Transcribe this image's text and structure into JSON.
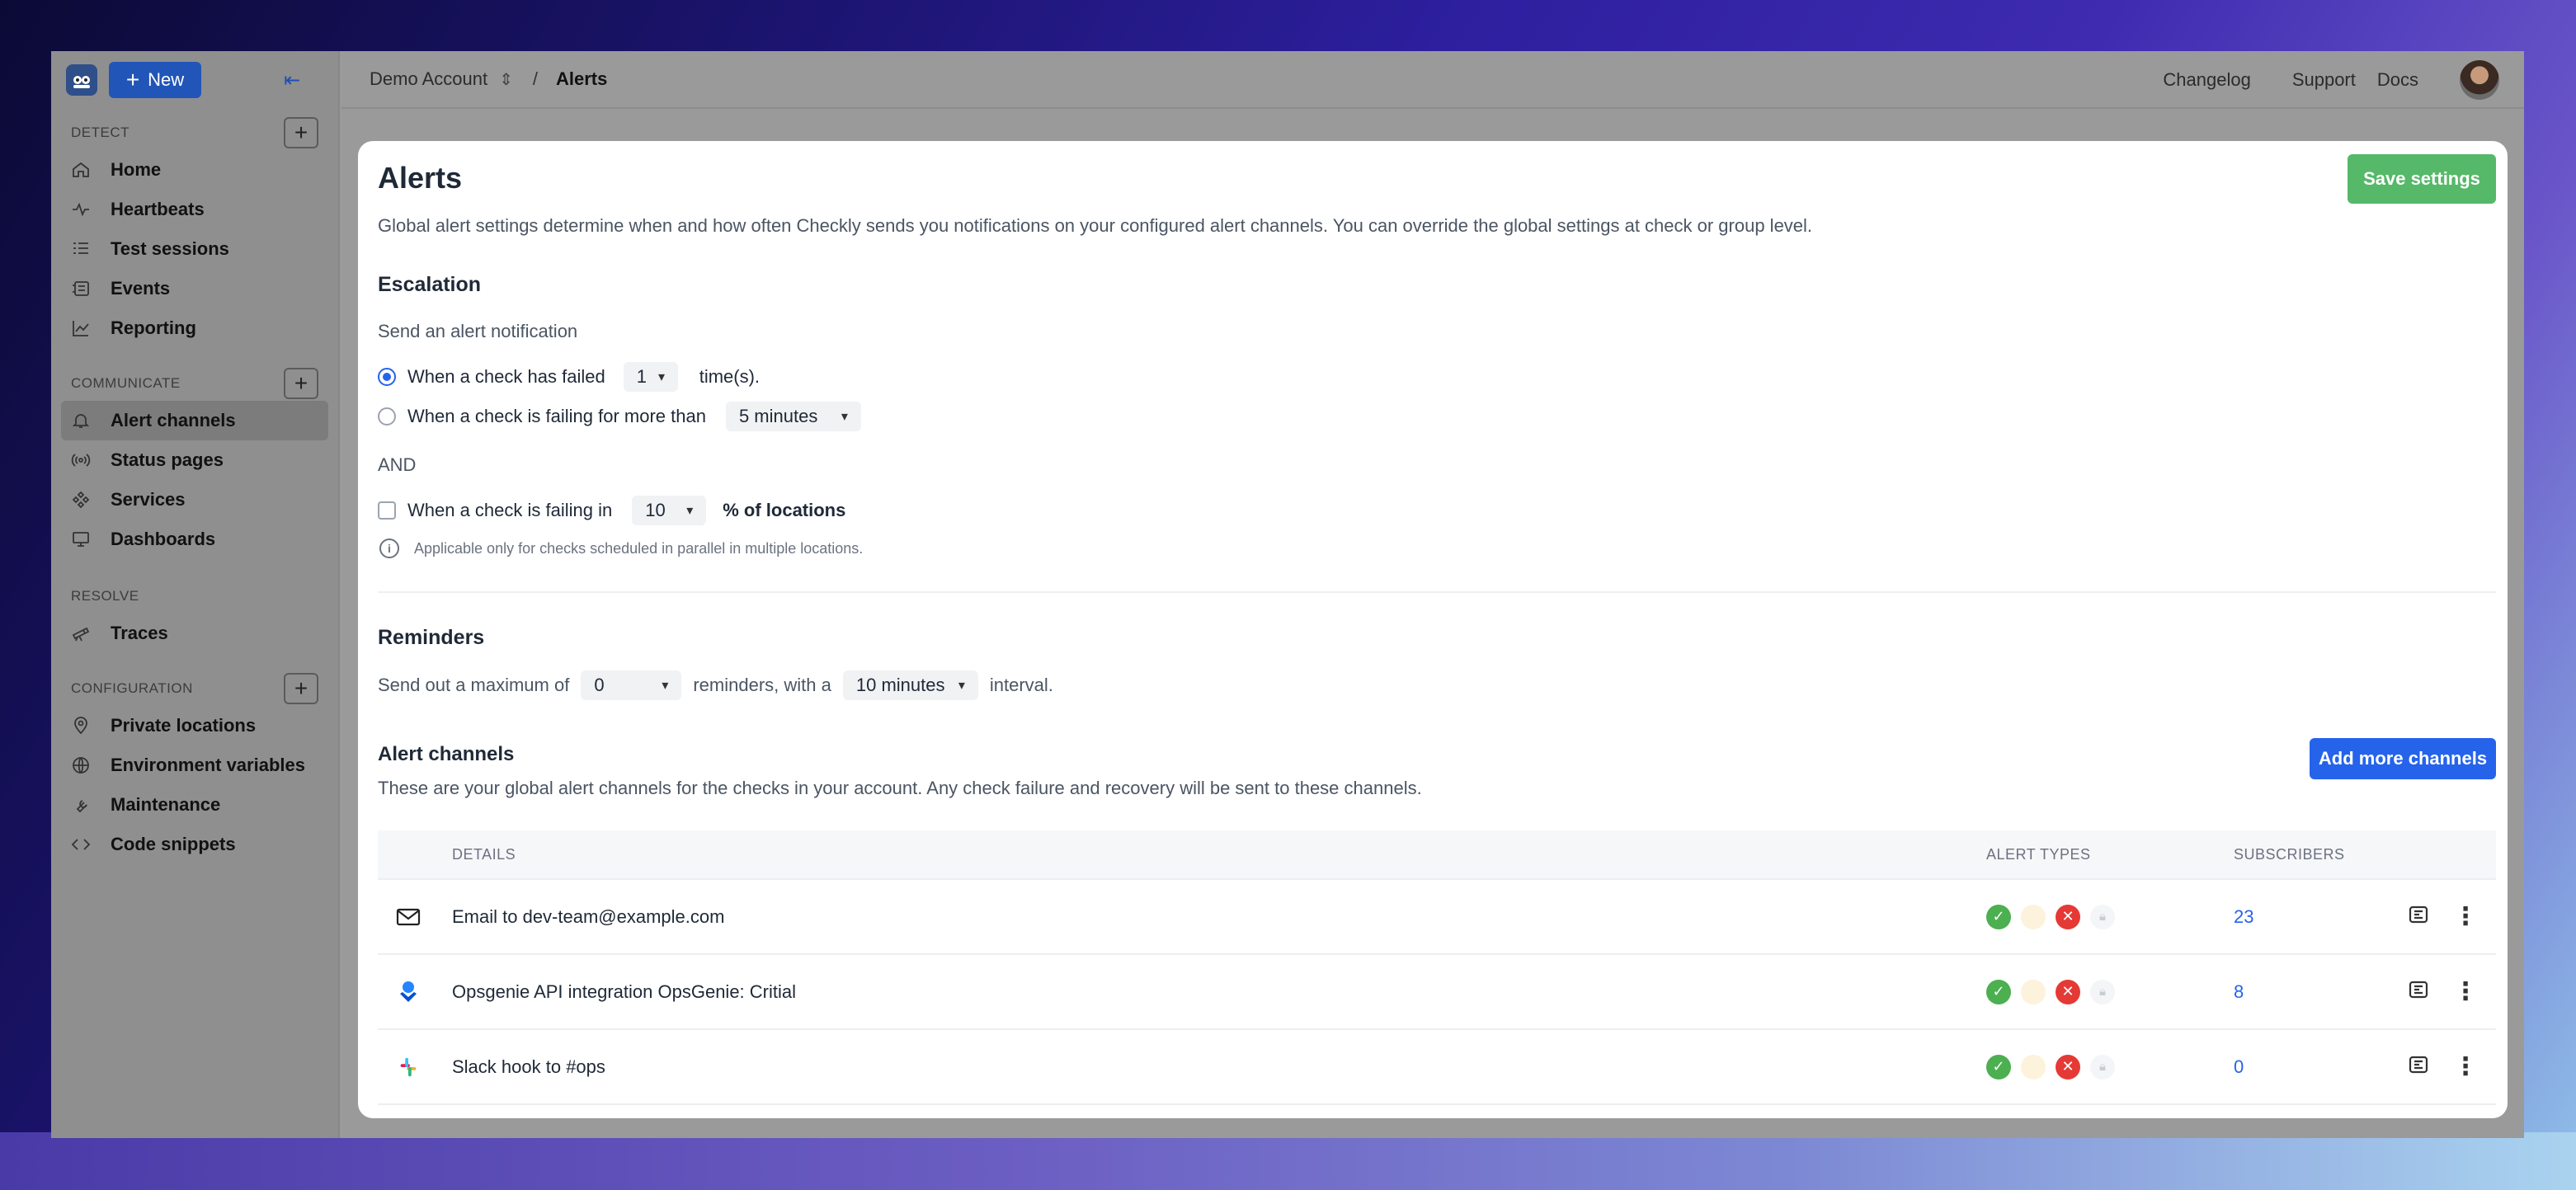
{
  "sidebar": {
    "new_label": "New",
    "sections": [
      {
        "title": "DETECT",
        "items": [
          {
            "label": "Home",
            "icon": "home-icon"
          },
          {
            "label": "Heartbeats",
            "icon": "heartbeat-icon"
          },
          {
            "label": "Test sessions",
            "icon": "test-sessions-icon"
          },
          {
            "label": "Events",
            "icon": "events-icon"
          },
          {
            "label": "Reporting",
            "icon": "reporting-icon"
          }
        ]
      },
      {
        "title": "COMMUNICATE",
        "items": [
          {
            "label": "Alert channels",
            "icon": "bell-icon"
          },
          {
            "label": "Status pages",
            "icon": "broadcast-icon"
          },
          {
            "label": "Services",
            "icon": "services-icon"
          },
          {
            "label": "Dashboards",
            "icon": "monitor-icon"
          }
        ]
      },
      {
        "title": "RESOLVE",
        "items": [
          {
            "label": "Traces",
            "icon": "telescope-icon"
          }
        ]
      },
      {
        "title": "CONFIGURATION",
        "items": [
          {
            "label": "Private locations",
            "icon": "location-pin-icon"
          },
          {
            "label": "Environment variables",
            "icon": "globe-icon"
          },
          {
            "label": "Maintenance",
            "icon": "wrench-icon"
          },
          {
            "label": "Code snippets",
            "icon": "code-icon"
          }
        ]
      }
    ]
  },
  "topbar": {
    "account": "Demo Account",
    "separator": "/",
    "crumb": "Alerts",
    "links": [
      "Changelog",
      "Support",
      "Docs"
    ]
  },
  "modal": {
    "title": "Alerts",
    "save_label": "Save settings",
    "description": "Global alert settings determine when and how often Checkly sends you notifications on your configured alert channels. You can override the global settings at check or group level.",
    "escalation": {
      "heading": "Escalation",
      "intro": "Send an alert notification",
      "option1_pre": "When a check has failed",
      "option1_value": "1",
      "option1_post": "time(s).",
      "option2_pre": "When a check is failing for more than",
      "option2_value": "5 minutes",
      "and_label": "AND",
      "loc_pre": "When a check is failing in",
      "loc_value": "10",
      "loc_post": "% of locations",
      "info": "Applicable only for checks scheduled in parallel in multiple locations."
    },
    "reminders": {
      "heading": "Reminders",
      "pre": "Send out a maximum of",
      "count": "0",
      "mid": "reminders, with a",
      "interval": "10 minutes",
      "post": "interval."
    },
    "channels": {
      "heading": "Alert channels",
      "add_label": "Add more channels",
      "description": "These are your global alert channels for the checks in your account. Any check failure and recovery will be sent to these channels.",
      "columns": {
        "details": "DETAILS",
        "types": "ALERT TYPES",
        "subscribers": "SUBSCRIBERS"
      },
      "rows": [
        {
          "detail": "Email to dev-team@example.com",
          "icon": "email-icon",
          "subscribers": "23"
        },
        {
          "detail": "Opsgenie API integration OpsGenie: Critial",
          "icon": "opsgenie-icon",
          "subscribers": "8"
        },
        {
          "detail": "Slack hook to #ops",
          "icon": "slack-icon",
          "subscribers": "0"
        }
      ]
    }
  },
  "colors": {
    "primary": "#2563eb",
    "save": "#56b869",
    "ok": "#4caf50",
    "fail": "#e53935"
  }
}
